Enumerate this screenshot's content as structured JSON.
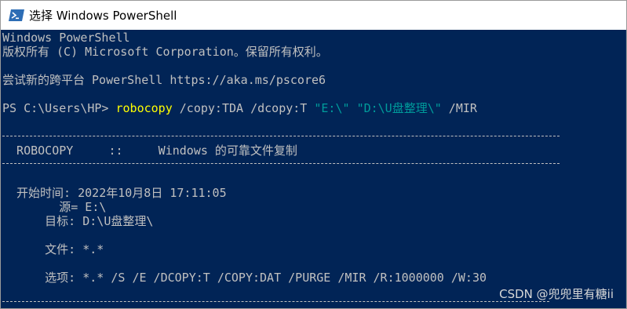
{
  "window": {
    "title": "选择 Windows PowerShell",
    "icon": "powershell-icon"
  },
  "console": {
    "banner_line1": "Windows PowerShell",
    "banner_line2": "版权所有 (C) Microsoft Corporation。保留所有权利。",
    "banner_line3": "尝试新的跨平台 PowerShell https://aka.ms/pscore6",
    "prompt": "PS C:\\Users\\HP> ",
    "command_name": "robocopy",
    "command_args1": " /copy:TDA /dcopy:T ",
    "command_src": "\"E:\\\"",
    "space": " ",
    "command_dst": "\"D:\\U盘整理\\\"",
    "command_args2": " /MIR",
    "header_line": "  ROBOCOPY     ::     Windows 的可靠文件复制",
    "start_time": "  开始时间: 2022年10月8日 17:11:05",
    "source": "        源= E:\\",
    "target": "      目标: D:\\U盘整理\\",
    "files": "      文件: *.*",
    "options": "      选项: *.* /S /E /DCOPY:T /COPY:DAT /PURGE /MIR /R:1000000 /W:30"
  },
  "watermark": "CSDN @兜兜里有糖ii",
  "colors": {
    "background": "#012456",
    "text": "#c0c0c0",
    "command": "#ffff00",
    "string": "#009b9b"
  }
}
